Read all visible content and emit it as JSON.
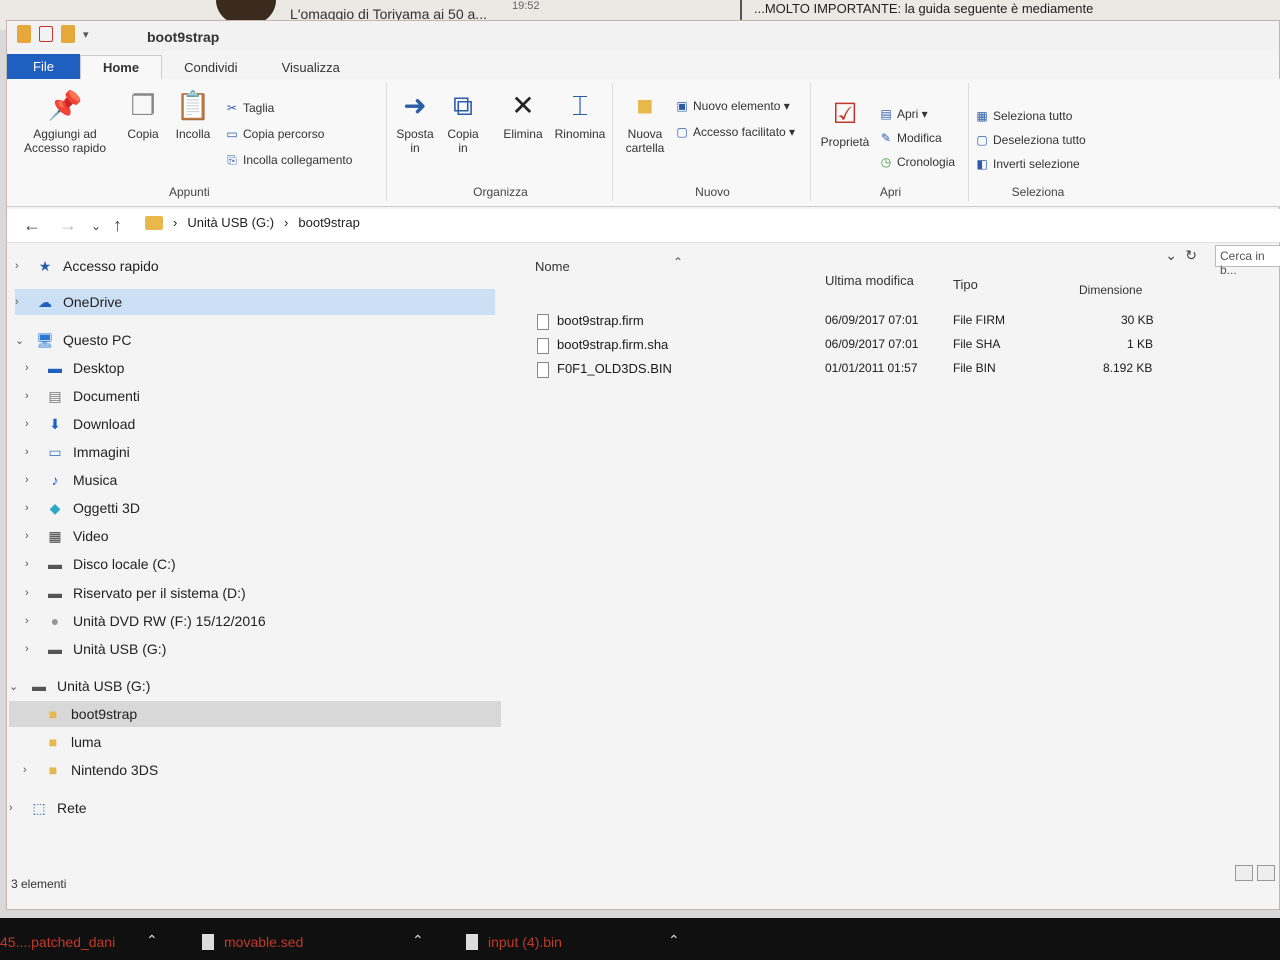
{
  "background": {
    "tab_title": "L'omaggio di Toriyama ai 50 a...",
    "time": "19:52",
    "notice": "...MOLTO IMPORTANTE: la guida seguente è mediamente complicata e richiede un minimo di dimestichezza con il PC. Se non credi di essere abbastanz..."
  },
  "window": {
    "title": "boot9strap",
    "minimize_glyph": "–",
    "maximize_glyph": "□"
  },
  "ribbon_tabs": [
    "File",
    "Home",
    "Condividi",
    "Visualizza"
  ],
  "ribbon": {
    "appunti": {
      "label": "Appunti",
      "pin": "Aggiungi ad Accesso rapido",
      "copy": "Copia",
      "paste": "Incolla",
      "cut": "Taglia",
      "copy_path": "Copia percorso",
      "paste_link": "Incolla collegamento"
    },
    "organizza": {
      "label": "Organizza",
      "move": "Sposta in",
      "copy_to": "Copia in",
      "delete": "Elimina",
      "rename": "Rinomina"
    },
    "nuovo": {
      "label": "Nuovo",
      "new_folder": "Nuova cartella",
      "new_item": "Nuovo elemento",
      "easy_access": "Accesso facilitato"
    },
    "apri": {
      "label": "Apri",
      "properties": "Proprietà",
      "open": "Apri",
      "edit": "Modifica",
      "history": "Cronologia"
    },
    "seleziona": {
      "label": "Seleziona",
      "select_all": "Seleziona tutto",
      "select_none": "Deseleziona tutto",
      "invert": "Inverti selezione"
    }
  },
  "address": {
    "crumbs": [
      "Unità USB (G:)",
      "boot9strap"
    ],
    "search_placeholder": "Cerca in b..."
  },
  "nav": {
    "quick_access": "Accesso rapido",
    "onedrive": "OneDrive",
    "this_pc": "Questo PC",
    "desktop": "Desktop",
    "documents": "Documenti",
    "downloads": "Download",
    "pictures": "Immagini",
    "music": "Musica",
    "objects3d": "Oggetti 3D",
    "videos": "Video",
    "local_disk": "Disco locale (C:)",
    "reserved": "Riservato per il sistema (D:)",
    "dvd": "Unità DVD RW (F:) 15/12/2016",
    "usb_a": "Unità USB (G:)",
    "usb_b": "Unità USB (G:)",
    "boot9strap": "boot9strap",
    "luma": "luma",
    "nintendo": "Nintendo 3DS",
    "network": "Rete"
  },
  "columns": {
    "name": "Nome",
    "modified": "Ultima modifica",
    "type": "Tipo",
    "size": "Dimensione"
  },
  "files": [
    {
      "name": "boot9strap.firm",
      "modified": "06/09/2017 07:01",
      "type": "File FIRM",
      "size": "30 KB"
    },
    {
      "name": "boot9strap.firm.sha",
      "modified": "06/09/2017 07:01",
      "type": "File SHA",
      "size": "1 KB"
    },
    {
      "name": "F0F1_OLD3DS.BIN",
      "modified": "01/01/2011 01:57",
      "type": "File BIN",
      "size": "8.192 KB"
    }
  ],
  "status": "3 elementi",
  "taskbar": [
    "45....patched_dani",
    "movable.sed",
    "input (4).bin"
  ],
  "icons": {
    "brand_blue": "#1f5fbf",
    "folder": "#e8b84a"
  }
}
